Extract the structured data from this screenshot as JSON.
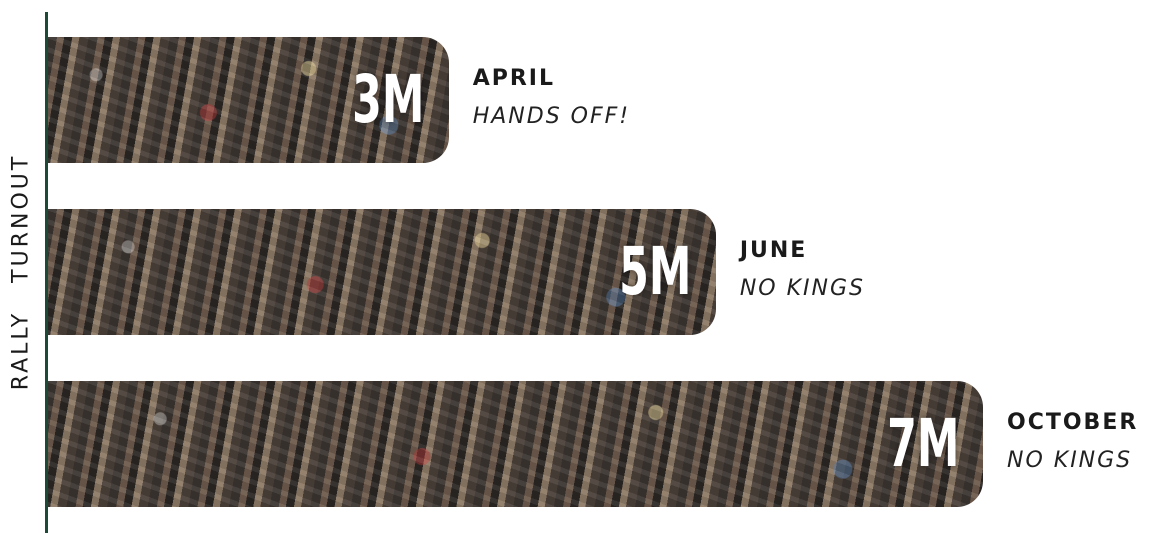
{
  "chart_data": {
    "type": "bar",
    "orientation": "horizontal",
    "ylabel": "RALLY TURNOUT",
    "categories": [
      "APRIL",
      "JUNE",
      "OCTOBER"
    ],
    "events": [
      "HANDS OFF!",
      "NO KINGS",
      "NO KINGS"
    ],
    "values": [
      3,
      5,
      7
    ],
    "value_labels": [
      "3M",
      "5M",
      "7M"
    ],
    "xlim": [
      0,
      7
    ],
    "colors": {
      "axis": "#1d4a37",
      "text": "#1a1a1a",
      "value_text": "#ffffff"
    }
  }
}
